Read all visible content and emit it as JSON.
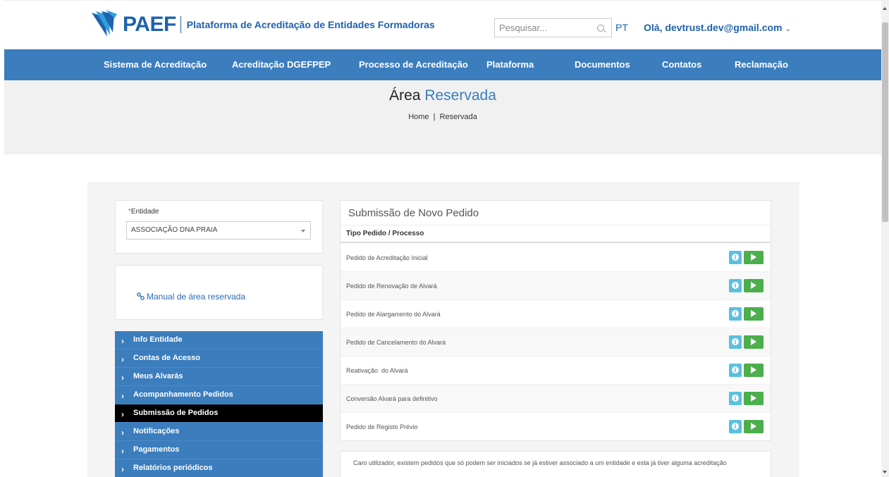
{
  "header": {
    "logo_text": "PAEF",
    "logo_subtitle": "Plataforma de Acreditação de Entidades Formadoras",
    "search_placeholder": "Pesquisar...",
    "language": "PT",
    "user_greeting": "Olá, devtrust.dev@gmail.com",
    "user_chevron": "⌄",
    "brand_color": "#1f62ad"
  },
  "nav": {
    "color": "#3b7dbd",
    "items": [
      {
        "label": "Sistema de Acreditação"
      },
      {
        "label": "Acreditação DGEFPEP"
      },
      {
        "label": "Processo de Acreditação"
      },
      {
        "label": "Plataforma"
      },
      {
        "label": "Documentos"
      },
      {
        "label": "Contatos"
      },
      {
        "label": "Reclamação"
      }
    ]
  },
  "banner": {
    "title_part1": "Área",
    "title_part2": "Reservada",
    "breadcrumb": "Home  |  Reservada"
  },
  "entity": {
    "required_marker": "*",
    "label": "Entidade",
    "selected": "ASSOCIAÇÃO DNA PRAIA"
  },
  "manual": {
    "icon": "link-icon",
    "link_text": "Manual de área reservada"
  },
  "side_menu": {
    "items": [
      {
        "label": "Info Entidade",
        "active": false
      },
      {
        "label": "Contas de Acesso",
        "active": false
      },
      {
        "label": "Meus Alvarás",
        "active": false
      },
      {
        "label": "Acompanhamento Pedidos",
        "active": false
      },
      {
        "label": "Submissão de Pedidos",
        "active": true
      },
      {
        "label": "Notificações",
        "active": false
      },
      {
        "label": "Pagamentos",
        "active": false
      },
      {
        "label": "Relatórios periódicos",
        "active": false
      }
    ]
  },
  "orders": {
    "title": "Submissão de Novo Pedido",
    "column_header": "Tipo Pedido / Processo",
    "rows": [
      {
        "label": "Pedido de Acreditação Inicial"
      },
      {
        "label": "Pedido de Renovação de Alvará"
      },
      {
        "label": "Pedido de Alargamento do Alvará"
      },
      {
        "label": "Pedido de Cancelamento do Alvará"
      },
      {
        "label": "Reativação  do Alvará"
      },
      {
        "label": "Conversão Alvará para definitivo"
      },
      {
        "label": "Pedido de Registo Prévio"
      }
    ],
    "info_button_color": "#5bc0de",
    "go_button_color": "#4cae4c"
  },
  "note": {
    "text": "Caro utilizador, existem pedidos que só podem ser iniciados se já estiver associado a um entidade e esta já tiver alguma acreditação"
  }
}
